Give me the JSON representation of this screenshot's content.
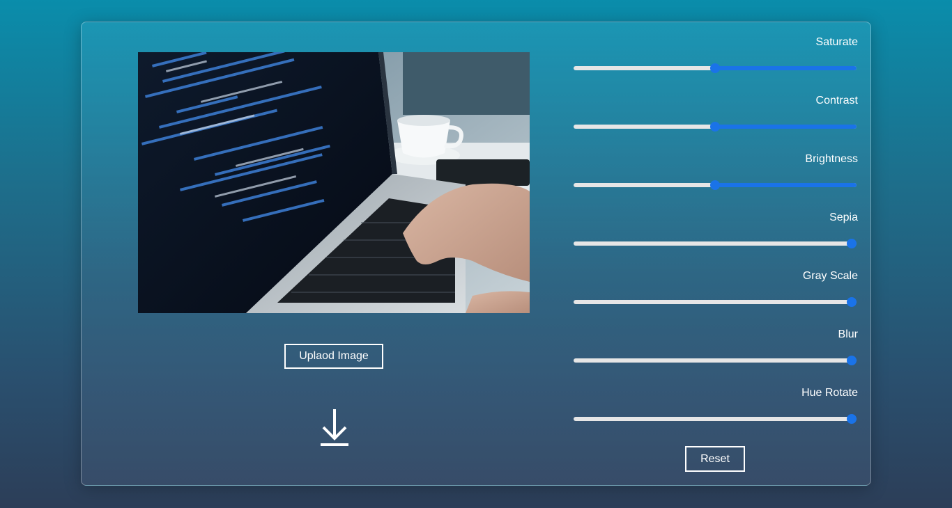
{
  "editor": {
    "upload_label": "Uplaod Image",
    "reset_label": "Reset",
    "download_icon": "download-icon",
    "image_subject": "laptop-code-photo"
  },
  "filters": [
    {
      "label": "Saturate",
      "value": 0.5,
      "fill_from": "thumb"
    },
    {
      "label": "Contrast",
      "value": 0.5,
      "fill_from": "thumb"
    },
    {
      "label": "Brightness",
      "value": 0.5,
      "fill_from": "thumb"
    },
    {
      "label": "Sepia",
      "value": 1.0,
      "fill_from": "none"
    },
    {
      "label": "Gray Scale",
      "value": 1.0,
      "fill_from": "none"
    },
    {
      "label": "Blur",
      "value": 1.0,
      "fill_from": "none"
    },
    {
      "label": "Hue Rotate",
      "value": 1.0,
      "fill_from": "none"
    }
  ],
  "colors": {
    "accent": "#1a73e8",
    "track": "#e6e6e6",
    "text": "#ffffff"
  }
}
